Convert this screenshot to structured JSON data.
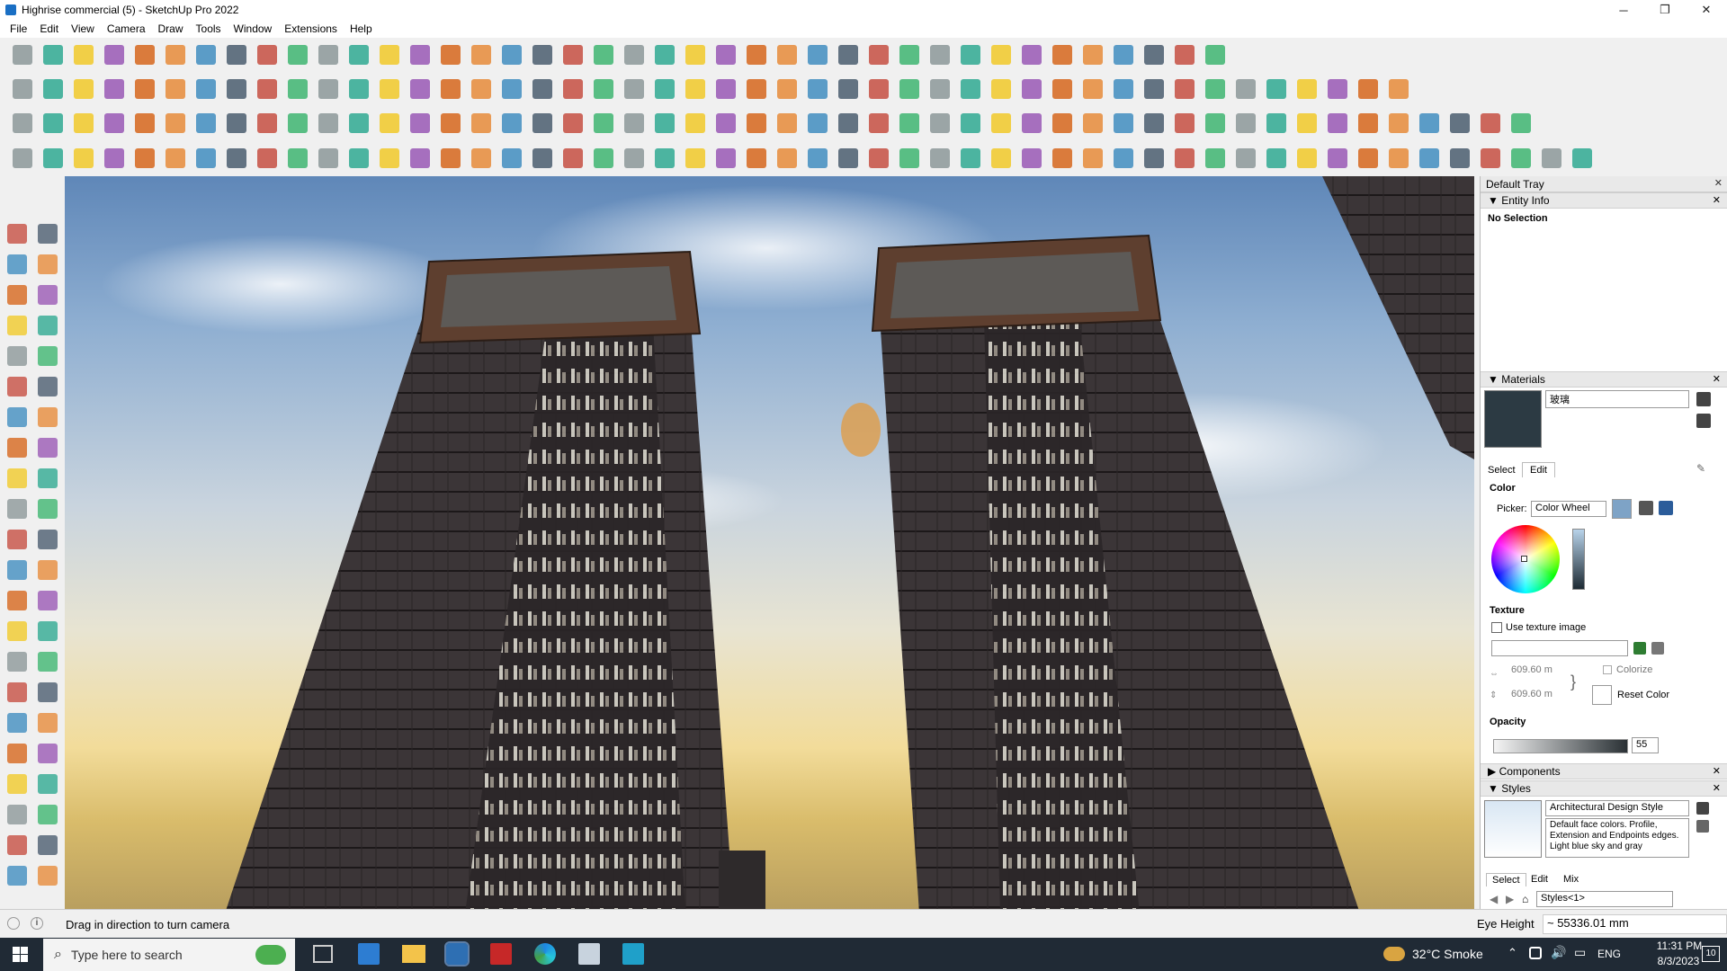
{
  "window": {
    "title": "Highrise commercial (5) - SketchUp Pro 2022",
    "minimize": "─",
    "restore": "❐",
    "close": "✕"
  },
  "menu": [
    "File",
    "Edit",
    "View",
    "Camera",
    "Draw",
    "Tools",
    "Window",
    "Extensions",
    "Help"
  ],
  "colors": {
    "accent": "#1a6fc4",
    "taskbar": "#202a35",
    "building": "#3a3436",
    "roof": "#6b4430"
  },
  "tray": {
    "title": "Default Tray",
    "entity_info": {
      "header": "Entity Info",
      "status": "No Selection"
    },
    "materials": {
      "header": "Materials",
      "name": "玻璃",
      "tabs": [
        "Select",
        "Edit"
      ],
      "color_label": "Color",
      "picker_label": "Picker:",
      "picker_value": "Color Wheel",
      "texture_label": "Texture",
      "use_texture": "Use texture image",
      "width": "609.60 m",
      "height": "609.60 m",
      "colorize": "Colorize",
      "reset_color": "Reset Color",
      "opacity_label": "Opacity",
      "opacity_value": "55",
      "swatch_color": "#2c3a43"
    },
    "components": {
      "header": "Components"
    },
    "styles": {
      "header": "Styles",
      "name": "Architectural Design Style",
      "description": "Default face colors. Profile, Extension and Endpoints edges. Light blue sky and gray",
      "tabs": [
        "Select",
        "Edit",
        "Mix"
      ],
      "collection": "Styles<1>"
    }
  },
  "status": {
    "hint": "Drag in direction to turn camera",
    "measure_label": "Eye Height",
    "measure_value": "~ 55336.01 mm"
  },
  "taskbar": {
    "search_placeholder": "Type here to search",
    "weather": "32°C  Smoke",
    "lang": "ENG",
    "time": "11:31 PM",
    "date": "8/3/2023",
    "notifications": "10"
  }
}
